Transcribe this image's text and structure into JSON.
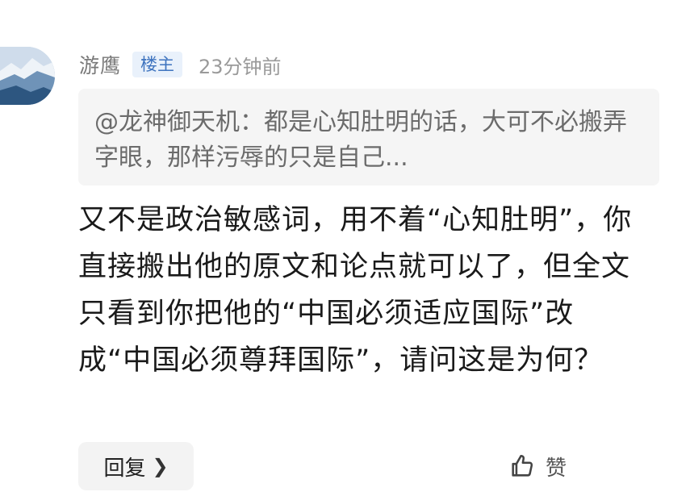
{
  "comment": {
    "username": "游鹰",
    "badge": "楼主",
    "timestamp": "23分钟前",
    "quote": "@龙神御天机：都是心知肚明的话，大可不必搬弄字眼，那样污辱的只是自己...",
    "body": "又不是政治敏感词，用不着“心知肚明”，你直接搬出他的原文和论点就可以了，但全文只看到你把他的“中国必须适应国际”改成“中国必须尊拜国际”，请问这是为何？",
    "reply_label": "回复",
    "like_label": "赞"
  },
  "icons": {
    "avatar": "mountain-avatar",
    "reply_chevron": "chevron-right-icon",
    "like": "thumbs-up-icon"
  },
  "colors": {
    "badge_bg": "#e9f1fb",
    "badge_text": "#3f74bf",
    "quote_bg": "#f5f5f5"
  }
}
